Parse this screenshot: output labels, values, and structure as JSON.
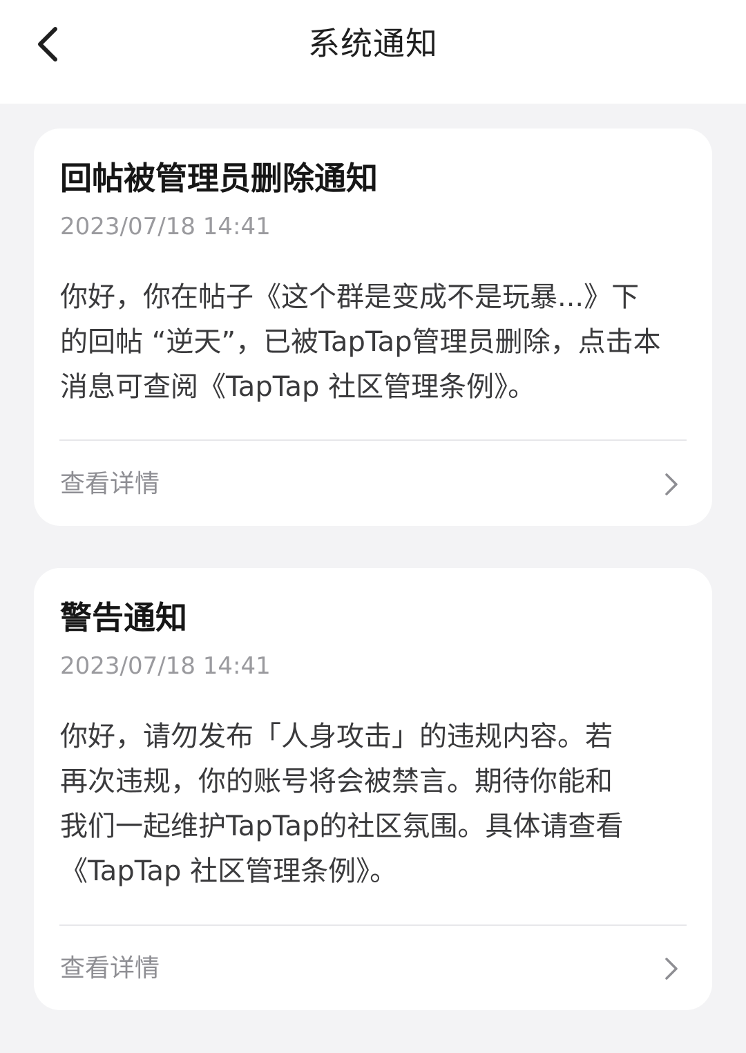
{
  "header": {
    "title": "系统通知",
    "back_icon": "chevron-left-icon"
  },
  "notifications": [
    {
      "title": "回帖被管理员删除通知",
      "time": "2023/07/18 14:41",
      "body_lines": [
        "你好，你在帖子《这个群是变成不是玩暴...》下",
        "的回帖 “逆天”，已被TapTap管理员删除，点击本",
        "消息可查阅《TapTap 社区管理条例》。"
      ],
      "detail_label": "查看详情"
    },
    {
      "title": "警告通知",
      "time": "2023/07/18 14:41",
      "body_lines": [
        "你好，请勿发布「人身攻击」的违规内容。若",
        "再次违规，你的账号将会被禁言。期待你能和",
        "我们一起维护TapTap的社区氛围。具体请查看",
        "《TapTap 社区管理条例》。"
      ],
      "detail_label": "查看详情"
    }
  ]
}
